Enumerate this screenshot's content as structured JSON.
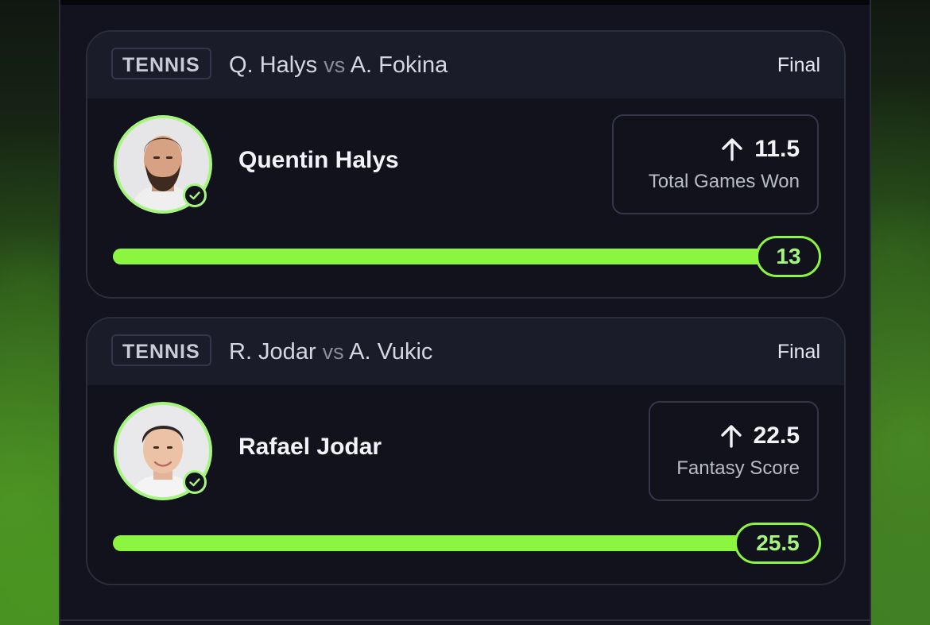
{
  "accent_color": "#8cf53f",
  "cards": [
    {
      "sport": "TENNIS",
      "player1": "Q. Halys",
      "vs": "vs",
      "player2": "A. Fokina",
      "status": "Final",
      "player_name": "Quentin Halys",
      "direction": "up",
      "line": "11.5",
      "stat": "Total Games Won",
      "result": "13",
      "progress_fraction": 1.0
    },
    {
      "sport": "TENNIS",
      "player1": "R. Jodar",
      "vs": "vs",
      "player2": "A. Vukic",
      "status": "Final",
      "player_name": "Rafael Jodar",
      "direction": "up",
      "line": "22.5",
      "stat": "Fantasy Score",
      "result": "25.5",
      "progress_fraction": 1.0
    }
  ]
}
